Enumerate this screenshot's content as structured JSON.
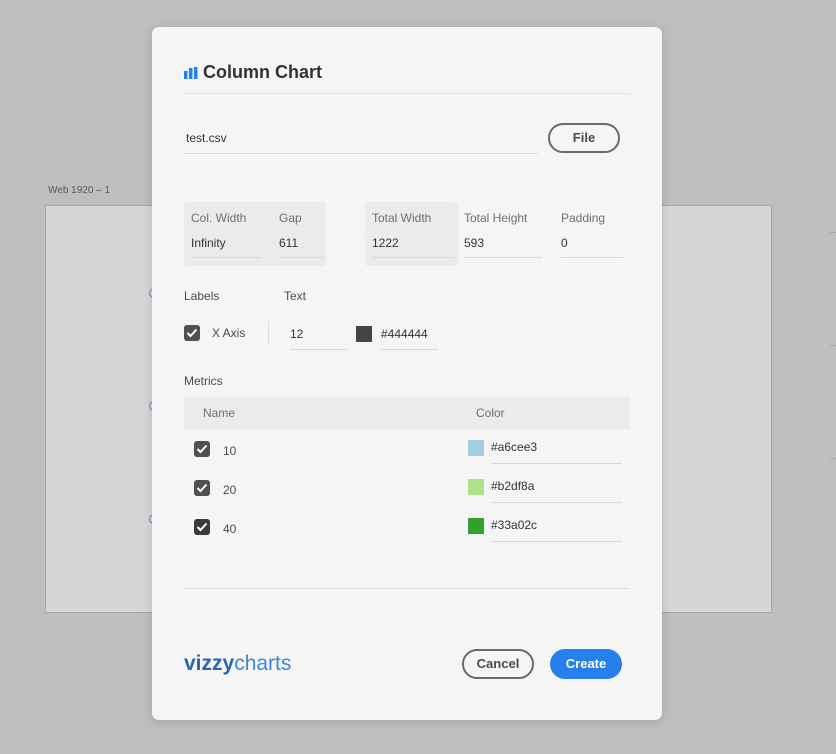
{
  "canvas": {
    "artboard_label": "Web 1920 – 1"
  },
  "dialog": {
    "title": "Column Chart",
    "file": {
      "name": "test.csv",
      "button_label": "File"
    },
    "dimensions": {
      "col_width": {
        "label": "Col. Width",
        "value": "Infinity"
      },
      "gap": {
        "label": "Gap",
        "value": "611"
      },
      "total_width": {
        "label": "Total Width",
        "value": "1222"
      },
      "total_height": {
        "label": "Total Height",
        "value": "593"
      },
      "padding": {
        "label": "Padding",
        "value": "0"
      }
    },
    "labels": {
      "section_label": "Labels",
      "x_axis": {
        "label": "X Axis",
        "checked": true
      },
      "text_label": "Text",
      "font_size": "12",
      "text_color": "#444444"
    },
    "metrics": {
      "section_label": "Metrics",
      "columns": {
        "name": "Name",
        "color": "Color"
      },
      "rows": [
        {
          "name": "10",
          "checked": true,
          "color": "#a6cee3"
        },
        {
          "name": "20",
          "checked": true,
          "color": "#b2df8a"
        },
        {
          "name": "40",
          "checked": true,
          "color": "#33a02c"
        }
      ]
    },
    "brand": {
      "part1": "vizzy",
      "part2": "charts"
    },
    "buttons": {
      "cancel": "Cancel",
      "create": "Create"
    }
  },
  "colors": {
    "accent": "#2680eb",
    "brand_dark": "#2a66ad",
    "brand_light": "#3d86d8",
    "checkbox": "#505050"
  },
  "icons": {
    "title_icon": "bar-chart-icon",
    "link_icon": "link-icon",
    "checkbox_icon": "checkmark-icon"
  }
}
